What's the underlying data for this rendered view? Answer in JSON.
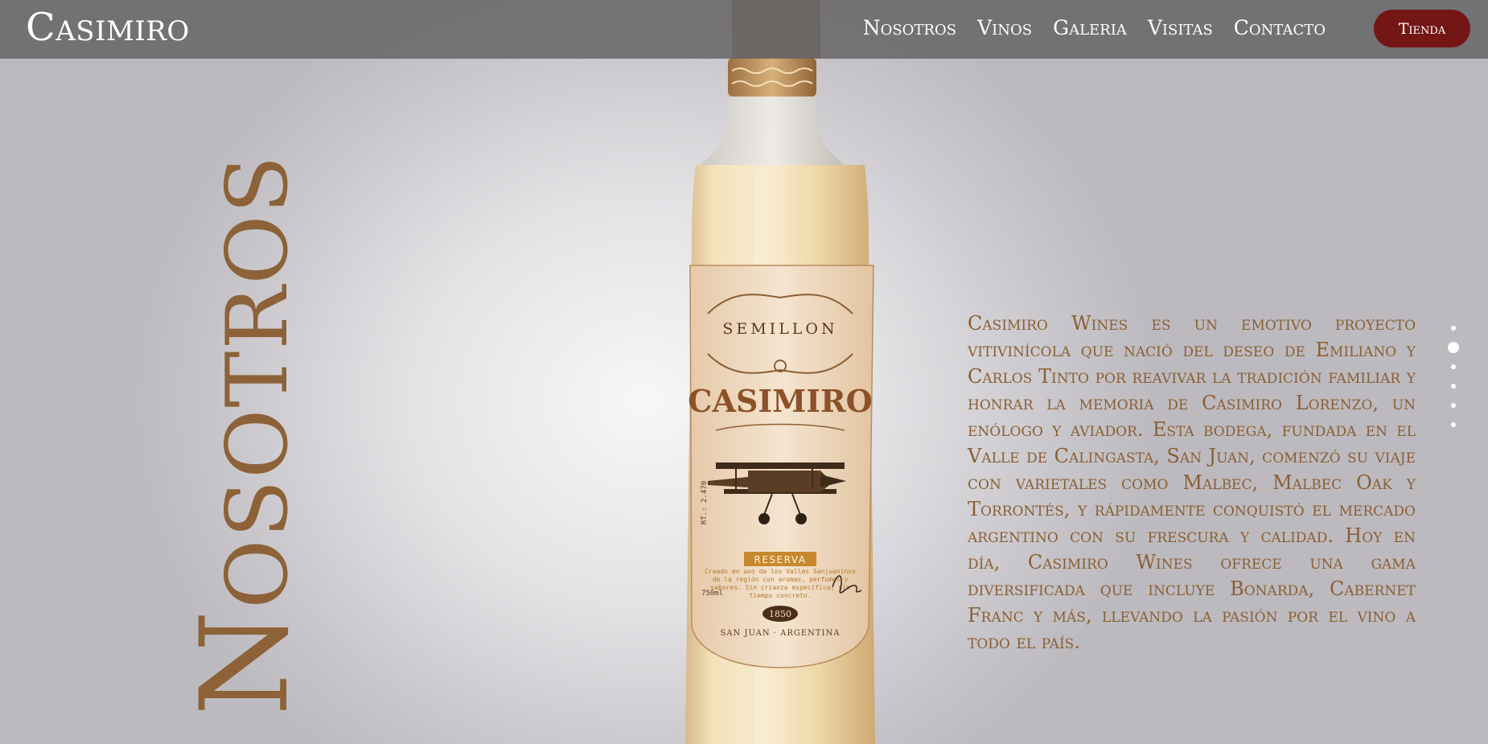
{
  "header": {
    "brand": "Casimiro",
    "nav": [
      "Nosotros",
      "Vinos",
      "Galeria",
      "Visitas",
      "Contacto"
    ],
    "shop_label": "Tienda"
  },
  "section": {
    "title": "Nosotros"
  },
  "bottle": {
    "varietal": "SEMILLON",
    "brand": "CASIMIRO",
    "badge": "RESERVA",
    "year": "1850",
    "origin": "SAN JUAN · ARGENTINA",
    "side_text": "RT.: 2.470",
    "volume": "750ml",
    "description": "Creado en uno de los Valles Sanjuaninos de la región con aromas, perfumes y sabores. Sin crianza específica, sin tiempo concreto."
  },
  "about": {
    "text": "Casimiro Wines es un emotivo proyecto vitivinícola que nació del deseo de Emiliano y Carlos Tinto por reavivar la tradición familiar y honrar la memoria de Casimiro Lorenzo, un enólogo y aviador. Esta bodega, fundada en el Valle de Calingasta, San Juan, comenzó su viaje con varietales como Malbec, Malbec Oak y Torrontés, y rápidamente conquistó el mercado argentino con su frescura y calidad. Hoy en día, Casimiro Wines ofrece una gama diversificada que incluye Bonarda, Cabernet Franc y más, llevando la pasión por el vino a todo el país."
  },
  "pagination": {
    "total": 6,
    "active_index": 1
  },
  "colors": {
    "accent_brown": "#8d6238",
    "shop_button": "#741516",
    "header_bg": "#626063"
  }
}
